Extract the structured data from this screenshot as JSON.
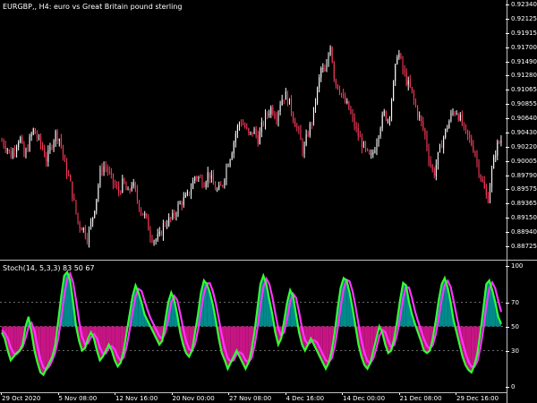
{
  "window": {
    "symbol_caption": "EURGBP,, H4:  euro vs Great Britain pound sterling",
    "indicator_caption": "Stoch(14, 5,3,3) 83 50 67"
  },
  "colors": {
    "background": "#000000",
    "bull_candle": "#ffffff",
    "bear_candle": "#ff3b5c",
    "stoch_main": "#33ff33",
    "stoch_signal": "#ff33ff",
    "fill_above": "#008b8b",
    "fill_below": "#c71585",
    "level_line": "#8a8a8a"
  },
  "price_axis": {
    "labels": [
      "0.92340",
      "0.92125",
      "0.91915",
      "0.91700",
      "0.91490",
      "0.91280",
      "0.91065",
      "0.90855",
      "0.90640",
      "0.90430",
      "0.90220",
      "0.90005",
      "0.89790",
      "0.89575",
      "0.89365",
      "0.89150",
      "0.88940",
      "0.88725"
    ]
  },
  "indicator_axis": {
    "labels": [
      "100",
      "70",
      "50",
      "30",
      "0"
    ],
    "levels": [
      70,
      50,
      30
    ]
  },
  "time_axis": {
    "labels": [
      "29 Oct 2020",
      "5 Nov 08:00",
      "12 Nov 16:00",
      "20 Nov 00:00",
      "27 Nov 08:00",
      "4 Dec 16:00",
      "14 Dec 00:00",
      "21 Dec 08:00",
      "29 Dec 16:00"
    ]
  },
  "chart_data": [
    {
      "type": "candlestick",
      "title": "EURGBP,, H4:  euro vs Great Britain pound sterling",
      "ylim": [
        0.8866,
        0.9238
      ],
      "close_path": [
        0.9028,
        0.902,
        0.9005,
        0.902,
        0.9035,
        0.9002,
        0.9025,
        0.9045,
        0.9032,
        0.9018,
        0.8998,
        0.9022,
        0.904,
        0.903,
        0.899,
        0.897,
        0.8935,
        0.89,
        0.8895,
        0.888,
        0.8905,
        0.894,
        0.8985,
        0.899,
        0.8975,
        0.896,
        0.895,
        0.8965,
        0.8945,
        0.8965,
        0.894,
        0.892,
        0.891,
        0.8885,
        0.8875,
        0.888,
        0.89,
        0.8905,
        0.891,
        0.8925,
        0.8935,
        0.894,
        0.8955,
        0.8975,
        0.897,
        0.8965,
        0.898,
        0.896,
        0.895,
        0.896,
        0.899,
        0.901,
        0.904,
        0.906,
        0.905,
        0.9035,
        0.9045,
        0.903,
        0.9055,
        0.907,
        0.908,
        0.9065,
        0.909,
        0.91,
        0.9085,
        0.906,
        0.904,
        0.901,
        0.904,
        0.906,
        0.91,
        0.914,
        0.913,
        0.918,
        0.912,
        0.911,
        0.909,
        0.908,
        0.906,
        0.904,
        0.9025,
        0.901,
        0.9,
        0.902,
        0.905,
        0.907,
        0.906,
        0.911,
        0.917,
        0.914,
        0.912,
        0.9105,
        0.908,
        0.906,
        0.904,
        0.9,
        0.8975,
        0.9005,
        0.903,
        0.905,
        0.907,
        0.9075,
        0.906,
        0.904,
        0.903,
        0.9015,
        0.8985,
        0.896,
        0.8935,
        0.8985,
        0.902,
        0.903
      ],
      "series": [
        {
          "name": "",
          "role": "bull-candle",
          "color": "#ffffff"
        },
        {
          "name": "",
          "role": "bear-candle",
          "color": "#ff3b5c"
        }
      ]
    },
    {
      "type": "line",
      "title": "Stoch(14, 5,3,3) 83 50 67",
      "ylim": [
        0,
        100
      ],
      "levels": [
        70,
        50,
        30
      ],
      "main": [
        45,
        40,
        30,
        22,
        25,
        28,
        30,
        35,
        50,
        58,
        45,
        30,
        20,
        12,
        10,
        15,
        20,
        25,
        35,
        55,
        75,
        92,
        95,
        88,
        70,
        50,
        38,
        30,
        32,
        40,
        45,
        40,
        30,
        22,
        25,
        30,
        35,
        30,
        22,
        17,
        20,
        30,
        45,
        60,
        75,
        84,
        78,
        70,
        60,
        55,
        50,
        45,
        40,
        35,
        38,
        55,
        70,
        78,
        72,
        60,
        45,
        35,
        28,
        25,
        30,
        45,
        60,
        78,
        88,
        85,
        78,
        68,
        55,
        40,
        28,
        22,
        15,
        20,
        25,
        30,
        25,
        20,
        15,
        20,
        30,
        45,
        65,
        85,
        92,
        85,
        72,
        60,
        45,
        35,
        40,
        55,
        70,
        80,
        75,
        60,
        45,
        35,
        30,
        35,
        40,
        35,
        30,
        25,
        20,
        15,
        20,
        30,
        45,
        65,
        82,
        90,
        88,
        78,
        65,
        50,
        35,
        25,
        18,
        15,
        20,
        30,
        40,
        50,
        45,
        35,
        28,
        30,
        40,
        55,
        72,
        86,
        84,
        70,
        60,
        52,
        45,
        38,
        30,
        28,
        30,
        40,
        55,
        72,
        85,
        90,
        82,
        70,
        55,
        45,
        35,
        25,
        18,
        14,
        12,
        18,
        28,
        45,
        65,
        85,
        88,
        80,
        70,
        58,
        52
      ],
      "signal_offset": 3,
      "series": [
        {
          "name": "",
          "role": "main",
          "color": "#33ff33"
        },
        {
          "name": "",
          "role": "signal",
          "color": "#ff33ff"
        }
      ]
    }
  ]
}
